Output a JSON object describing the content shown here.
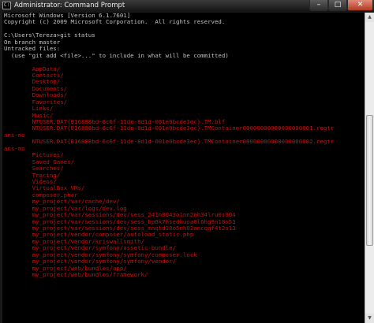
{
  "window": {
    "title": "Administrator: Command Prompt",
    "icon_glyph": "C:\\",
    "minimize_glyph": "–",
    "maximize_glyph": "□",
    "close_glyph": "✕"
  },
  "scrollbar": {
    "up_glyph": "▲",
    "down_glyph": "▼",
    "position_fraction": 0.58
  },
  "colors": {
    "untracked": "#c4120e",
    "text": "#c3c3c3",
    "background": "#000000"
  },
  "console": {
    "lines": [
      {
        "text": "Microsoft Windows [Version 6.1.7601]",
        "color": "default"
      },
      {
        "text": "Copyright (c) 2009 Microsoft Corporation.  All rights reserved.",
        "color": "default"
      },
      {
        "text": "",
        "color": "default"
      },
      {
        "text": "C:\\Users\\Tereza>git status",
        "color": "default"
      },
      {
        "text": "On branch master",
        "color": "default"
      },
      {
        "text": "Untracked files:",
        "color": "default"
      },
      {
        "text": "  (use \"git add <file>...\" to include in what will be committed)",
        "color": "default"
      },
      {
        "text": "",
        "color": "default"
      },
      {
        "text": "        AppData/",
        "color": "red"
      },
      {
        "text": "        Contacts/",
        "color": "red"
      },
      {
        "text": "        Desktop/",
        "color": "red"
      },
      {
        "text": "        Documents/",
        "color": "red"
      },
      {
        "text": "        Downloads/",
        "color": "red"
      },
      {
        "text": "        Favorites/",
        "color": "red"
      },
      {
        "text": "        Links/",
        "color": "red"
      },
      {
        "text": "        Music/",
        "color": "red"
      },
      {
        "text": "        NTUSER.DAT{016888bd-6c6f-11de-8d1d-001e0bcde3ec}.TM.blf",
        "color": "red"
      },
      {
        "text": "        NTUSER.DAT{016888bd-6c6f-11de-8d1d-001e0bcde3ec}.TMContainer00000000000000000001.regtr",
        "color": "red"
      },
      {
        "text": "ans-ms",
        "color": "red"
      },
      {
        "text": "        NTUSER.DAT{016888bd-6c6f-11de-8d1d-001e0bcde3ec}.TMContainer00000000000000000002.regtr",
        "color": "red"
      },
      {
        "text": "ans-ms",
        "color": "red"
      },
      {
        "text": "        Pictures/",
        "color": "red"
      },
      {
        "text": "        Saved Games/",
        "color": "red"
      },
      {
        "text": "        Searches/",
        "color": "red"
      },
      {
        "text": "        Tracing/",
        "color": "red"
      },
      {
        "text": "        Videos/",
        "color": "red"
      },
      {
        "text": "        VirtualBox VMs/",
        "color": "red"
      },
      {
        "text": "        composer.phar",
        "color": "red"
      },
      {
        "text": "        my_project/var/cache/dev/",
        "color": "red"
      },
      {
        "text": "        my_project/var/logs/dev.log",
        "color": "red"
      },
      {
        "text": "        my_project/var/sessions/dev/sess_241n0043o1nn2nh34lru0s904",
        "color": "red"
      },
      {
        "text": "        my_project/var/sessions/dev/sess_bp8k7hsedkuoa0l6hg9n18s53",
        "color": "red"
      },
      {
        "text": "        my_project/var/sessions/dev/sess_mnqtd10o5nh02ancqgf4t2s13",
        "color": "red"
      },
      {
        "text": "        my_project/vendor/composer/autoload_static.php",
        "color": "red"
      },
      {
        "text": "        my_project/vendor/kriswallsmith/",
        "color": "red"
      },
      {
        "text": "        my_project/vendor/symfony/assetic-bundle/",
        "color": "red"
      },
      {
        "text": "        my_project/vendor/symfony/symfony/composer.lock",
        "color": "red"
      },
      {
        "text": "        my_project/vendor/symfony/symfony/vendor/",
        "color": "red"
      },
      {
        "text": "        my_project/web/bundles/app/",
        "color": "red"
      },
      {
        "text": "        my_project/web/bundles/framework/",
        "color": "red"
      }
    ]
  }
}
